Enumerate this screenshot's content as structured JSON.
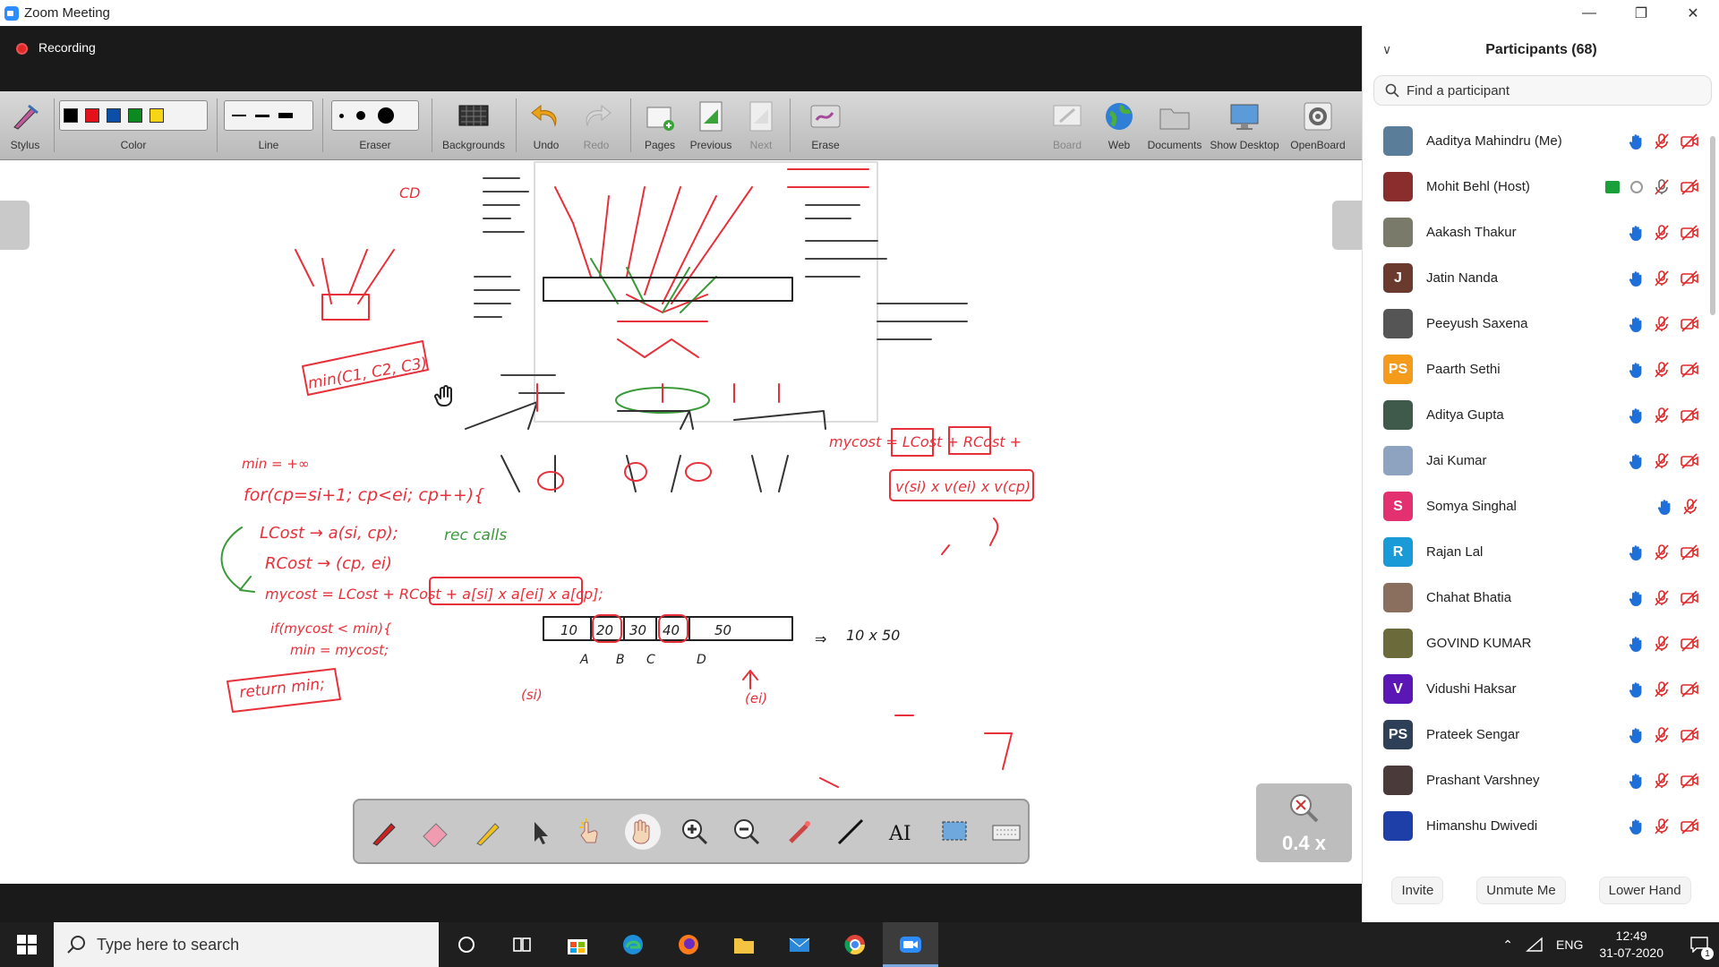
{
  "window": {
    "title": "Zoom Meeting"
  },
  "meeting": {
    "recording_label": "Recording"
  },
  "toolbar": {
    "stylus": "Stylus",
    "color": "Color",
    "line": "Line",
    "eraser": "Eraser",
    "backgrounds": "Backgrounds",
    "undo": "Undo",
    "redo": "Redo",
    "pages": "Pages",
    "previous": "Previous",
    "next": "Next",
    "erase": "Erase",
    "board": "Board",
    "web": "Web",
    "documents": "Documents",
    "show_desktop": "Show Desktop",
    "openboard": "OpenBoard"
  },
  "colors": {
    "black": "#000000",
    "red": "#e5111a",
    "blue": "#0d4fa8",
    "green": "#0d8a1f",
    "yellow": "#f7d516",
    "ink_red": "#e8303a",
    "ink_green": "#3a9a3a"
  },
  "zoom_level": "0.4 x",
  "participants": {
    "header": "Participants (68)",
    "search_placeholder": "Find a participant",
    "list": [
      {
        "name": "Aaditya Mahindru (Me)",
        "initial": "",
        "color": "#5a7d9a"
      },
      {
        "name": "Mohit Behl (Host)",
        "initial": "",
        "color": "#8a2d2d"
      },
      {
        "name": "Aakash Thakur",
        "initial": "",
        "color": "#7a7a6a"
      },
      {
        "name": "Jatin Nanda",
        "initial": "J",
        "color": "#6b3a2e"
      },
      {
        "name": "Peeyush Saxena",
        "initial": "",
        "color": "#555"
      },
      {
        "name": "Paarth Sethi",
        "initial": "PS",
        "color": "#f59b1c"
      },
      {
        "name": "Aditya Gupta",
        "initial": "",
        "color": "#3f5a4a"
      },
      {
        "name": "Jai Kumar",
        "initial": "",
        "color": "#8ea3c0"
      },
      {
        "name": "Somya Singhal",
        "initial": "S",
        "color": "#e3306f"
      },
      {
        "name": "Rajan Lal",
        "initial": "R",
        "color": "#1a9ad6"
      },
      {
        "name": "Chahat Bhatia",
        "initial": "",
        "color": "#8a6e5e"
      },
      {
        "name": "GOVIND KUMAR",
        "initial": "",
        "color": "#6a6a3a"
      },
      {
        "name": "Vidushi Haksar",
        "initial": "V",
        "color": "#5b17b6"
      },
      {
        "name": "Prateek Sengar",
        "initial": "PS",
        "color": "#2e4057"
      },
      {
        "name": "Prashant Varshney",
        "initial": "",
        "color": "#4a3a3a"
      },
      {
        "name": "Himanshu Dwivedi",
        "initial": "",
        "color": "#1e3fa8"
      }
    ],
    "buttons": {
      "invite": "Invite",
      "unmute": "Unmute Me",
      "lower_hand": "Lower Hand"
    }
  },
  "taskbar": {
    "search_placeholder": "Type here to search",
    "lang": "ENG",
    "time": "12:49",
    "date": "31-07-2020",
    "notification_count": "1"
  },
  "board_notes": {
    "min_line": "min = +∞",
    "for_line": "for(cp=si+1; cp<ei; cp++){",
    "lcost": "LCost → a(si, cp);",
    "rcost": "RCost → (cp, ei)",
    "rec_calls": "rec calls",
    "mycost": "mycost = LCost + RCost + a[si] x a[ei] x a[cp];",
    "if_line": "if(mycost < min){",
    "min_assign": "min = mycost;",
    "return_line": "return min;",
    "array": [
      "10",
      "20",
      "30",
      "40",
      "50"
    ],
    "array_labels": [
      "A",
      "B",
      "C",
      "D"
    ],
    "si": "(si)",
    "ei": "(ei)",
    "mycost_right": "mycost = LCost + RCost +",
    "product": "v(si) x v(ei) x v(cp)",
    "tenx50": "10 x 50",
    "min_c": "min(C1, C2, C3)",
    "cd": "CD"
  }
}
